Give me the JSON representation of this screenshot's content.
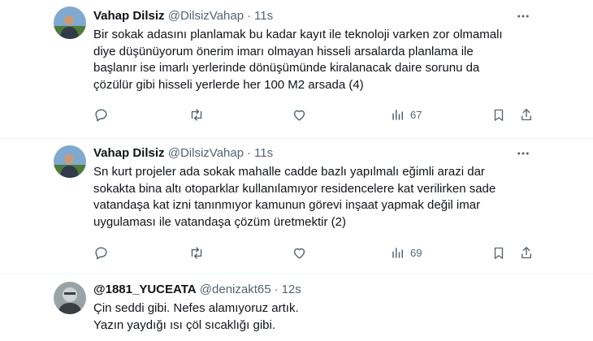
{
  "tweets": [
    {
      "name": "Vahap Dilsiz",
      "handle": "@DilsizVahap",
      "time": "11s",
      "lines": [
        "Bir sokak adasını planlamak bu kadar kayıt ile teknoloji varken zor olmamalı",
        "diye düşünüyorum önerim imarı olmayan hisseli arsalarda planlama ile",
        "başlanır ise imarlı yerlerinde dönüşümünde kiralanacak daire sorunu da",
        "çözülür gibi hisseli yerlerde her 100 M2 arsada (4)"
      ],
      "views": "67",
      "avatar_colors": {
        "sky": "#7fa9cf",
        "grass": "#4e7a3a",
        "person": "#2f3a4a"
      }
    },
    {
      "name": "Vahap Dilsiz",
      "handle": "@DilsizVahap",
      "time": "11s",
      "lines": [
        "Sn kurt projeler ada sokak mahalle cadde bazlı yapılmalı eğimli arazi dar",
        "sokakta bina altı otoparklar kullanılamıyor residencelere kat verilirken sade",
        "vatandaşa kat izni tanınmıyor kamunun görevi inşaat yapmak değil imar",
        "uygulaması ile vatandaşa çözüm üretmektir (2)"
      ],
      "views": "69",
      "avatar_colors": {
        "sky": "#7fa9cf",
        "grass": "#4e7a3a",
        "person": "#2f3a4a"
      }
    },
    {
      "name": "@1881_YUCEATA",
      "handle": "@denizakt65",
      "time": "12s",
      "lines": [
        "Çin seddi gibi. Nefes alamıyoruz artık.",
        "Yazın yaydığı ısı çöl sıcaklığı gibi."
      ],
      "avatar_colors": {
        "sky": "#9aa3a8",
        "grass": "#5c6368",
        "person": "#3a3f43"
      }
    }
  ],
  "icons": {
    "more": "more-horizontal-icon",
    "reply": "reply-icon",
    "retweet": "retweet-icon",
    "like": "heart-icon",
    "views": "views-chart-icon",
    "bookmark": "bookmark-icon",
    "share": "share-icon"
  },
  "colors": {
    "text": "#0f1419",
    "muted": "#536471",
    "divider": "#eff3f4"
  }
}
